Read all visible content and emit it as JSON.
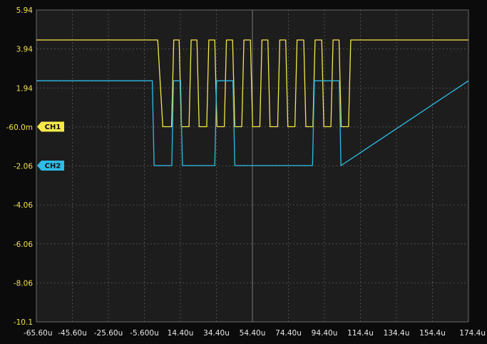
{
  "chart_data": {
    "type": "line",
    "x_unit": "u",
    "xlim": [
      -65.6,
      174.4
    ],
    "ylim": [
      -10.1,
      5.94
    ],
    "x_ticks": [
      "-65.60u",
      "-45.60u",
      "-25.60u",
      "-5.600u",
      "14.40u",
      "34.40u",
      "54.40u",
      "74.40u",
      "94.40u",
      "114.4u",
      "134.4u",
      "154.4u",
      "174.4u"
    ],
    "y_ticks": [
      "5.94",
      "3.94",
      "1.94",
      "-60.0m",
      "-2.06",
      "-4.06",
      "-6.06",
      "-8.06",
      "-10.1"
    ],
    "grid": true,
    "markers": [
      {
        "label": "CH1",
        "color": "#f5ea4a",
        "level": -0.06
      },
      {
        "label": "CH2",
        "color": "#2dbde8",
        "level": -2.06
      }
    ],
    "series": [
      {
        "name": "CH1",
        "color": "#f5e64a",
        "x": [
          -65.6,
          0.8,
          1.8,
          4.6,
          5.6,
          9.5,
          10.7,
          13.7,
          14.9,
          19.2,
          20.4,
          23.6,
          24.8,
          29.0,
          30.2,
          33.5,
          34.7,
          38.8,
          40.0,
          43.4,
          44.6,
          48.5,
          49.7,
          53.3,
          54.5,
          58.5,
          59.7,
          63.0,
          64.2,
          68.4,
          69.6,
          72.9,
          74.1,
          78.0,
          79.2,
          82.9,
          84.1,
          88.0,
          89.2,
          92.9,
          94.1,
          98.0,
          99.2,
          102.5,
          103.7,
          107.8,
          109.0,
          174.4
        ],
        "y": [
          4.4,
          4.4,
          4.4,
          -0.06,
          -0.06,
          -0.06,
          4.4,
          4.4,
          -0.06,
          -0.06,
          4.4,
          4.4,
          -0.06,
          -0.06,
          4.4,
          4.4,
          -0.06,
          -0.06,
          4.4,
          4.4,
          -0.06,
          -0.06,
          4.4,
          4.4,
          -0.06,
          -0.06,
          4.4,
          4.4,
          -0.06,
          -0.06,
          4.4,
          4.4,
          -0.06,
          -0.06,
          4.4,
          4.4,
          -0.06,
          -0.06,
          4.4,
          4.4,
          -0.06,
          -0.06,
          4.4,
          4.4,
          -0.06,
          -0.06,
          4.4,
          4.4
        ]
      },
      {
        "name": "CH2",
        "color": "#2dbde8",
        "x": [
          -65.6,
          -1.2,
          -0.2,
          9.6,
          10.6,
          14.5,
          15.5,
          33.5,
          34.5,
          43.6,
          44.6,
          87.8,
          88.8,
          102.6,
          103.6,
          174.4
        ],
        "y": [
          2.3,
          2.3,
          -2.06,
          -2.06,
          2.3,
          2.3,
          -2.06,
          -2.06,
          2.3,
          2.3,
          -2.06,
          -2.06,
          2.3,
          2.3,
          -2.06,
          2.3
        ]
      }
    ]
  }
}
